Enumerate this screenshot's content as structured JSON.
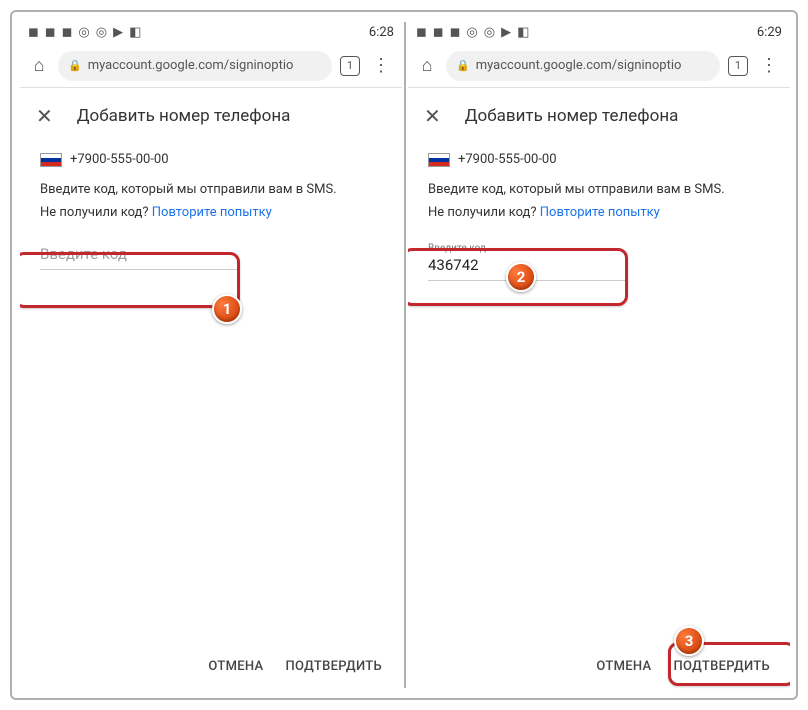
{
  "left": {
    "status": {
      "time": "6:28"
    },
    "browser": {
      "url": "myaccount.google.com/signinoptio",
      "tab_count": "1"
    },
    "header": {
      "title": "Добавить номер телефона"
    },
    "phone_number": "+7900-555-00-00",
    "instruction_line1": "Введите код, который мы отправили вам в SMS.",
    "instruction_line2_prefix": "Не получили код? ",
    "retry_link": "Повторите попытку",
    "code_input": {
      "placeholder": "Введите код",
      "value": ""
    },
    "buttons": {
      "cancel": "ОТМЕНА",
      "confirm": "ПОДТВЕРДИТЬ"
    },
    "callout_number": "1"
  },
  "right": {
    "status": {
      "time": "6:29"
    },
    "browser": {
      "url": "myaccount.google.com/signinoptio",
      "tab_count": "1"
    },
    "header": {
      "title": "Добавить номер телефона"
    },
    "phone_number": "+7900-555-00-00",
    "instruction_line1": "Введите код, который мы отправили вам в SMS.",
    "instruction_line2_prefix": "Не получили код? ",
    "retry_link": "Повторите попытку",
    "code_input": {
      "label": "Введите код",
      "value": "436742"
    },
    "buttons": {
      "cancel": "ОТМЕНА",
      "confirm": "ПОДТВЕРДИТЬ"
    },
    "callout_number_input": "2",
    "callout_number_confirm": "3"
  }
}
